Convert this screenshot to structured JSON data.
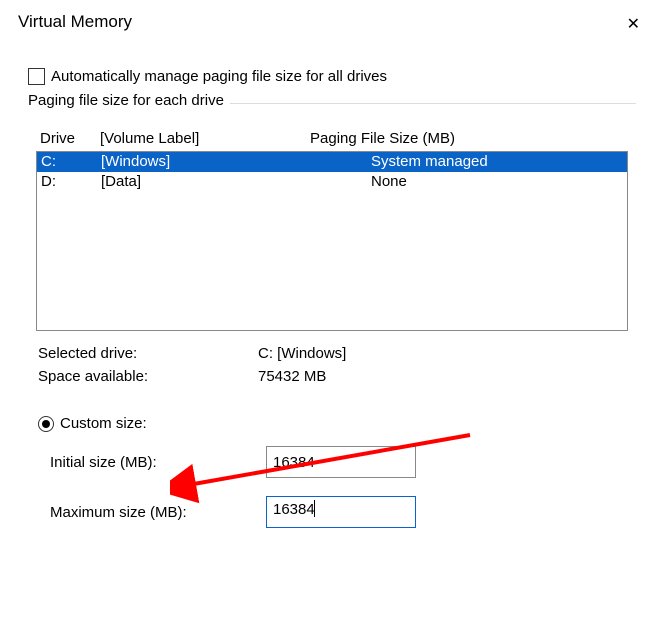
{
  "title": "Virtual Memory",
  "auto_manage_label": "Automatically manage paging file size for all drives",
  "fieldset_title": "Paging file size for each drive",
  "columns": {
    "drive": "Drive",
    "label": "[Volume Label]",
    "pfs": "Paging File Size (MB)"
  },
  "drives": [
    {
      "drive": "C:",
      "label": "[Windows]",
      "pfs": "System managed",
      "selected": true
    },
    {
      "drive": "D:",
      "label": "[Data]",
      "pfs": "None",
      "selected": false
    }
  ],
  "selected_drive_label": "Selected drive:",
  "selected_drive_value": "C:  [Windows]",
  "space_available_label": "Space available:",
  "space_available_value": "75432 MB",
  "custom_size_label": "Custom size:",
  "initial_size_label": "Initial size (MB):",
  "initial_size_value": "16384",
  "maximum_size_label": "Maximum size (MB):",
  "maximum_size_value": "16384"
}
